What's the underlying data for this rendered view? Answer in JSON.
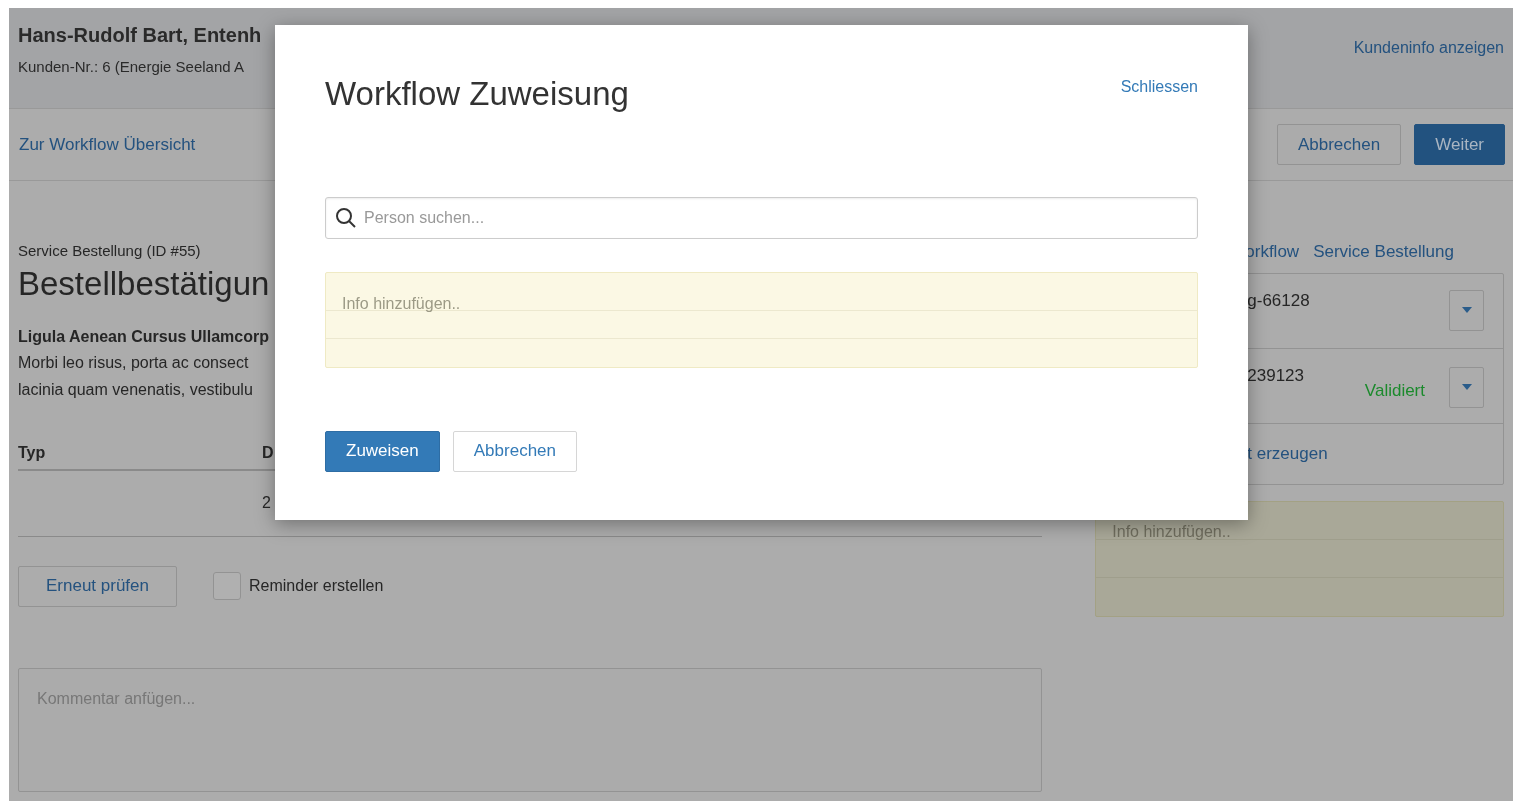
{
  "header": {
    "customer_name": "Hans-Rudolf Bart, Entenh",
    "customer_number": "Kunden-Nr.: 6 (Energie Seeland A",
    "customer_info_link": "Kundeninfo anzeigen"
  },
  "toolbar": {
    "back_link": "Zur Workflow Übersicht",
    "buttons": [
      {
        "label": "Abbrechen",
        "kind": "secondary"
      },
      {
        "label": "Weiter",
        "kind": "primary"
      }
    ]
  },
  "order": {
    "subtitle": "Service Bestellung (ID #55)",
    "title": "Bestellbestätigun",
    "heading": "Ligula Aenean Cursus Ullamcorp",
    "text_lines": [
      "Morbi leo risus, porta ac consect",
      "lacinia quam venenatis, vestibulu"
    ]
  },
  "table": {
    "columns": [
      "Typ",
      "D"
    ],
    "rows": [
      {
        "column_2": "2"
      }
    ]
  },
  "recheck_button": "Erneut prüfen",
  "reminder": {
    "label": "Reminder erstellen",
    "checked": false
  },
  "comment": {
    "placeholder": "Kommentar anfügen..."
  },
  "sidebar": {
    "breadcrumb": [
      "orkflow",
      "Service Bestellung"
    ],
    "items": [
      {
        "label": "g-66128"
      },
      {
        "label": "239123",
        "status": "Validiert"
      }
    ],
    "create_link": "t erzeugen",
    "note": {
      "placeholder": "Info hinzufügen.."
    }
  },
  "modal": {
    "title": "Workflow Zuweisung",
    "close_link": "Schliessen",
    "search": {
      "placeholder": "Person suchen..."
    },
    "note": {
      "placeholder": "Info hinzufügen.."
    },
    "buttons": [
      {
        "label": "Zuweisen",
        "kind": "primary"
      },
      {
        "label": "Abbrechen",
        "kind": "secondary"
      }
    ]
  }
}
